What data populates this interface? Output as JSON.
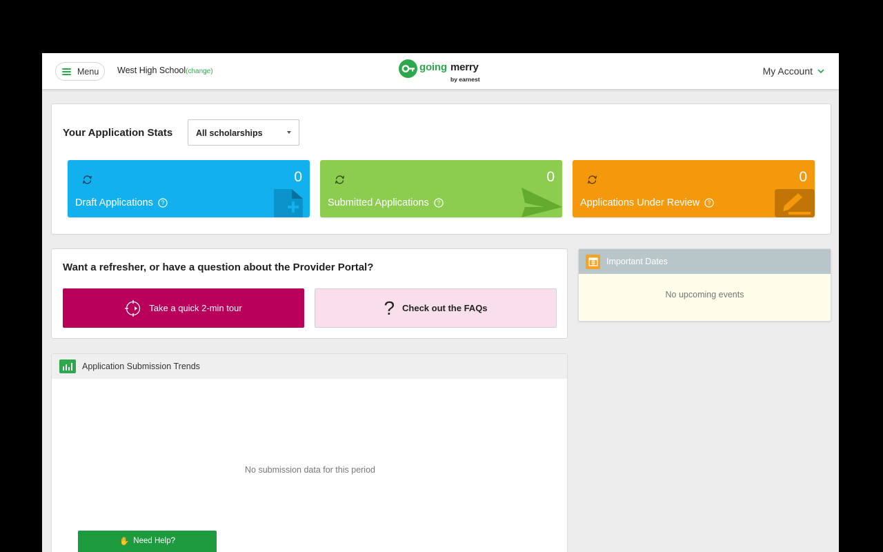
{
  "header": {
    "menu_label": "Menu",
    "school_name": "West High School",
    "change_label": "(change)",
    "logo": {
      "word1": "going",
      "word2": "merry",
      "byline": "by earnest"
    },
    "account_label": "My Account"
  },
  "stats": {
    "title": "Your Application Stats",
    "filter_value": "All scholarships",
    "cards": [
      {
        "label": "Draft Applications",
        "count": "0",
        "color": "#12b0ec",
        "icon": "document-icon"
      },
      {
        "label": "Submitted Applications",
        "count": "0",
        "color": "#8ccc4e",
        "icon": "send-icon"
      },
      {
        "label": "Applications Under Review",
        "count": "0",
        "color": "#f4990c",
        "icon": "edit-icon"
      }
    ]
  },
  "refresher": {
    "title": "Want a refresher, or have a question about the Provider Portal?",
    "tour_label": "Take a quick 2-min tour",
    "faq_label": "Check out the FAQs",
    "faq_glyph": "?"
  },
  "dates": {
    "title": "Important Dates",
    "empty": "No upcoming events"
  },
  "trends": {
    "title": "Application Submission Trends",
    "empty": "No submission data for this period"
  },
  "help_button": {
    "emoji": "✋",
    "label": "Need Help?"
  },
  "colors": {
    "brand_green": "#2ea84c",
    "tour_magenta": "#b8005a",
    "faq_pink": "#f8dfeb"
  }
}
